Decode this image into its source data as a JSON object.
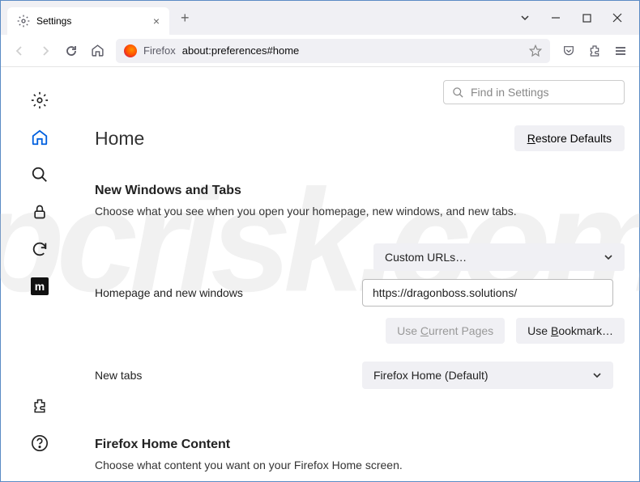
{
  "tab": {
    "title": "Settings"
  },
  "url": {
    "host": "Firefox",
    "path": "about:preferences#home"
  },
  "search": {
    "placeholder": "Find in Settings"
  },
  "page": {
    "title": "Home"
  },
  "buttons": {
    "restore_prefix": "R",
    "restore_rest": "estore Defaults",
    "use_current_prefix": "Use ",
    "use_current_u": "C",
    "use_current_rest": "urrent Pages",
    "use_bookmark_prefix": "Use ",
    "use_bookmark_u": "B",
    "use_bookmark_rest": "ookmark…"
  },
  "sections": {
    "new_windows": {
      "title": "New Windows and Tabs",
      "desc": "Choose what you see when you open your homepage, new windows, and new tabs.",
      "homepage_label": "Homepage and new windows",
      "homepage_dropdown": "Custom URLs…",
      "homepage_value": "https://dragonboss.solutions/",
      "newtabs_label": "New tabs",
      "newtabs_dropdown": "Firefox Home (Default)"
    },
    "home_content": {
      "title": "Firefox Home Content",
      "desc": "Choose what content you want on your Firefox Home screen."
    }
  },
  "sidebar": {
    "m_label": "m"
  }
}
